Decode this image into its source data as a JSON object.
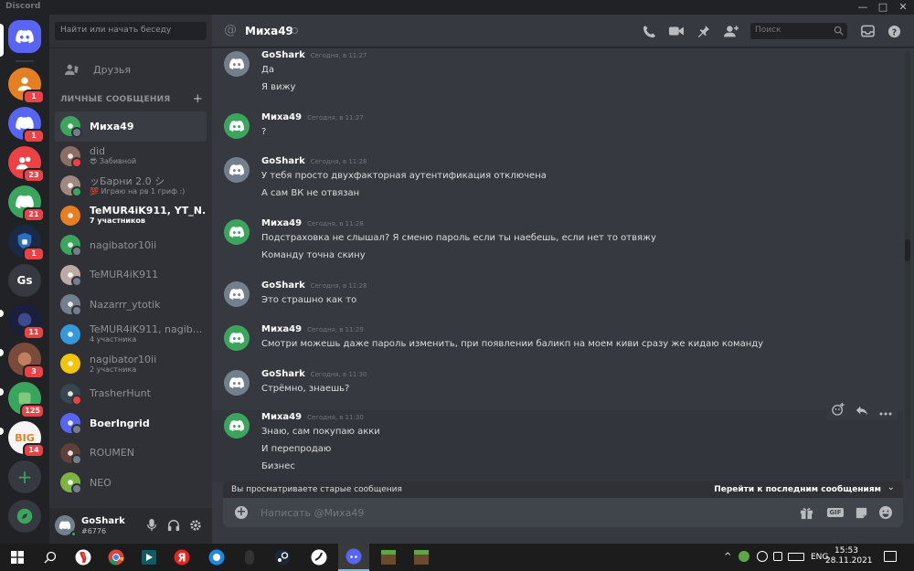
{
  "window": {
    "title": "Discord",
    "controls": [
      "—",
      "□",
      "✕"
    ]
  },
  "colors": {
    "blurple": "#5865f2",
    "green": "#3ba55d",
    "red": "#ed4245",
    "orange": "#e67e22",
    "yellow": "#f1c40f",
    "gray": "#747f8d"
  },
  "servers": [
    {
      "kind": "home",
      "label": ""
    },
    {
      "kind": "dm",
      "badge": "1"
    },
    {
      "kind": "dm",
      "badge": "1"
    },
    {
      "kind": "dm",
      "badge": "23"
    },
    {
      "kind": "dm",
      "badge": "21"
    },
    {
      "kind": "server",
      "badge": "1"
    },
    {
      "kind": "server",
      "label": "Gs"
    },
    {
      "kind": "server",
      "badge": "11"
    },
    {
      "kind": "server",
      "badge": "3"
    },
    {
      "kind": "server",
      "badge": "125"
    },
    {
      "kind": "server",
      "label": "BIG",
      "badge": "14"
    }
  ],
  "sidebar": {
    "search_placeholder": "Найти или начать беседу",
    "friends_label": "Друзья",
    "dm_header": "ЛИЧНЫЕ СООБЩЕНИЯ",
    "add_dm": "+",
    "dms": [
      {
        "name": "Миха49",
        "sub": "",
        "status": "offline",
        "color": "#3ba55d",
        "selected": true
      },
      {
        "name": "did",
        "sub": "😎 Забивной",
        "status": "dnd",
        "color": "#8d6e63"
      },
      {
        "name": "ッБарни 2.0 シ",
        "sub": "💯 Играю на рв 1 гриф :)",
        "status": "online",
        "color": "#a1887f"
      },
      {
        "name": "TeMUR4iK911, YT_N...",
        "sub": "7 участников",
        "status": "",
        "color": "#e67e22",
        "bold": true
      },
      {
        "name": "nagibator10ii",
        "sub": "",
        "status": "offline",
        "color": "#3ba55d"
      },
      {
        "name": "TeMUR4iK911",
        "sub": "",
        "status": "offline",
        "color": "#bcaaa4"
      },
      {
        "name": "Nazarrr_ytotik",
        "sub": "",
        "status": "offline",
        "color": "#747f8d"
      },
      {
        "name": "TeMUR4iK911, nagib...",
        "sub": "4 участника",
        "status": "",
        "color": "#3498db"
      },
      {
        "name": "nagibator10ii",
        "sub": "2 участника",
        "status": "",
        "color": "#f1c40f"
      },
      {
        "name": "TrasherHunt",
        "sub": "",
        "status": "dnd",
        "color": "#37474f"
      },
      {
        "name": "BoerIngrid",
        "sub": "",
        "status": "offline",
        "color": "#5865f2",
        "bold": true
      },
      {
        "name": "ROUMEN",
        "sub": "",
        "status": "offline",
        "color": "#5d4037"
      },
      {
        "name": "NEO",
        "sub": "",
        "status": "offline",
        "color": "#7cb342"
      }
    ]
  },
  "user": {
    "name": "GoShark",
    "tag": "#6776"
  },
  "chat": {
    "at": "@",
    "name": "Миха49",
    "search_placeholder": "Поиск",
    "groups": [
      {
        "author": "GoShark",
        "time": "Сегодня, в 11:27",
        "color": "#747f8d",
        "lines": [
          "Да",
          "Я вижу"
        ]
      },
      {
        "author": "Миха49",
        "time": "Сегодня, в 11:27",
        "color": "#3ba55d",
        "lines": [
          "?"
        ]
      },
      {
        "author": "GoShark",
        "time": "Сегодня, в 11:28",
        "color": "#747f8d",
        "lines": [
          "У тебя просто двухфакторная аутентификация отключена",
          "А сам ВК не отвязан"
        ]
      },
      {
        "author": "Миха49",
        "time": "Сегодня, в 11:28",
        "color": "#3ba55d",
        "lines": [
          "Подстраховка не слышал? Я сменю пароль если ты наебешь, если нет то отвяжу",
          "Команду точна скину"
        ]
      },
      {
        "author": "GoShark",
        "time": "Сегодня, в 11:28",
        "color": "#747f8d",
        "lines": [
          "Это страшно как то"
        ]
      },
      {
        "author": "Миха49",
        "time": "Сегодня, в 11:29",
        "color": "#3ba55d",
        "lines": [
          "Смотри можешь даже пароль изменить, при появлении баликп на моем киви сразу же кидаю команду"
        ]
      },
      {
        "author": "GoShark",
        "time": "Сегодня, в 11:30",
        "color": "#747f8d",
        "lines": [
          "Стрёмно, знаешь?"
        ]
      },
      {
        "author": "Миха49",
        "time": "Сегодня, в 11:30",
        "color": "#3ba55d",
        "lines": [
          "Знаю, сам покупаю акки",
          "И перепродаю",
          "Бизнес"
        ]
      }
    ],
    "old_notice": "Вы просматриваете старые сообщения",
    "jump_label": "Перейти к последним сообщениям",
    "composer_placeholder": "Написать @Миха49",
    "gif_label": "GIF"
  },
  "taskbar": {
    "lang": "ENG",
    "time": "15:53",
    "date": "28.11.2021"
  }
}
